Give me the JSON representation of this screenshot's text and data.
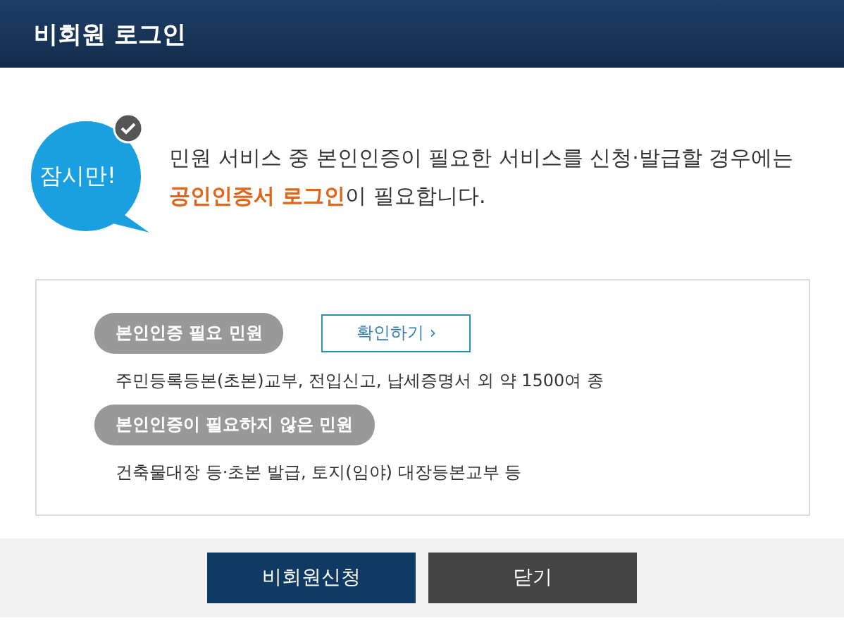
{
  "window": {
    "title": "비회원 로그인"
  },
  "notice": {
    "badge": "잠시만!",
    "message": "민원 서비스 중 본인인증이 필요한 서비스를 신청·발급할 경우에는 **공인인증서 로그인**이 필요합니다."
  },
  "sections": [
    {
      "label": "본인인증 필요 민원",
      "button": "확인하기 ›",
      "description": "주민등록등본(초본)교부, 전입신고, 납세증명서 외 약 1500여 종"
    },
    {
      "label": "본인인증이 필요하지 않은 민원",
      "description": "건축물대장 등·초본 발급, 토지(임야) 대장등본교부 등"
    }
  ],
  "buttons": [
    {
      "label": "비회원신청",
      "kind": "primary"
    },
    {
      "label": "닫기",
      "kind": "secondary"
    }
  ]
}
